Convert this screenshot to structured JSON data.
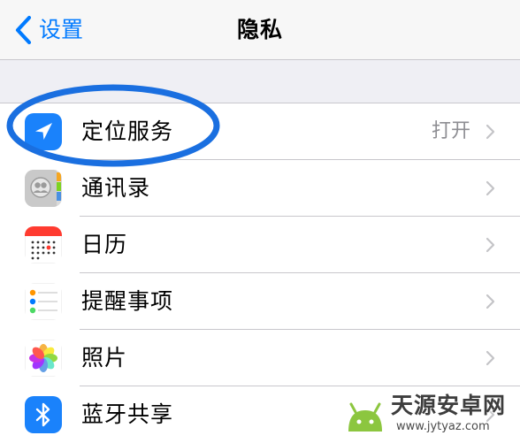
{
  "navbar": {
    "back_label": "设置",
    "title": "隐私"
  },
  "rows": [
    {
      "label": "定位服务",
      "value": "打开",
      "icon": "location-arrow-icon"
    },
    {
      "label": "通讯录",
      "value": "",
      "icon": "contacts-icon"
    },
    {
      "label": "日历",
      "value": "",
      "icon": "calendar-icon"
    },
    {
      "label": "提醒事项",
      "value": "",
      "icon": "reminders-icon"
    },
    {
      "label": "照片",
      "value": "",
      "icon": "photos-icon"
    },
    {
      "label": "蓝牙共享",
      "value": "",
      "icon": "bluetooth-icon"
    }
  ],
  "colors": {
    "accent": "#007aff",
    "highlight_ring": "#1a6fe0",
    "separator": "#c8c7cc",
    "secondary_text": "#8e8e93"
  },
  "watermark": {
    "title": "天源安卓网",
    "url": "www.jytyaz.com"
  }
}
